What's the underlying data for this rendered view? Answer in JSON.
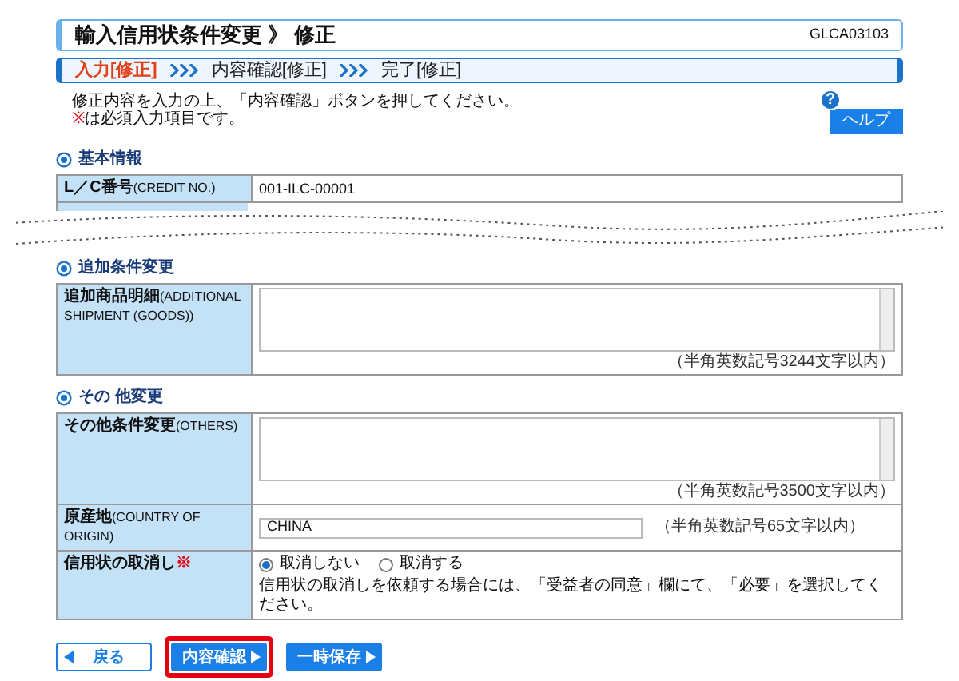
{
  "header": {
    "title": "輸入信用状条件変更 》 修正",
    "screen_id": "GLCA03103"
  },
  "steps": [
    {
      "label": "入力[修正]",
      "selected": true
    },
    {
      "label": "内容確認[修正]",
      "selected": false
    },
    {
      "label": "完了[修正]",
      "selected": false
    }
  ],
  "instructions": {
    "line_1": "修正内容を入力の上、「内容確認」ボタンを押してください。",
    "required_mark": "※",
    "line_2": "は必須入力項目です。"
  },
  "help_button": {
    "icon_glyph": "?",
    "label": "ヘルプ"
  },
  "sections": [
    {
      "title": "基本情報",
      "rows": [
        {
          "kind": "text",
          "label": "L／C番号",
          "label_en": "(CREDIT NO.)",
          "value": "001-ILC-00001"
        }
      ]
    },
    {
      "title": "追加条件変更",
      "rows": [
        {
          "kind": "textarea",
          "label": "追加商品明細",
          "label_en": "(ADDITIONAL SHIPMENT (GOODS))",
          "value": "",
          "hint": "（半角英数記号3244文字以内）"
        }
      ]
    },
    {
      "title": "その 他変更",
      "rows": [
        {
          "kind": "textarea",
          "label": "その他条件変更",
          "label_en": "(OTHERS)",
          "value": "",
          "hint": "（半角英数記号3500文字以内）"
        },
        {
          "kind": "input",
          "label": "原産地",
          "label_en": "(COUNTRY OF ORIGIN)",
          "value": "CHINA",
          "hint": "（半角英数記号65文字以内）"
        },
        {
          "kind": "radio",
          "label": "信用状の取消し",
          "required_mark": "※",
          "options": [
            {
              "label": "取消しない",
              "selected": true
            },
            {
              "label": "取消する",
              "selected": false
            }
          ],
          "note": "信用状の取消しを依頼する場合には、「受益者の同意」欄にて、「必要」を選択してください。"
        }
      ]
    }
  ],
  "buttons": [
    {
      "kind": "back",
      "label": "戻る"
    },
    {
      "kind": "next",
      "label": "内容確認",
      "highlighted": true
    },
    {
      "kind": "next",
      "label": "一時保存"
    }
  ]
}
